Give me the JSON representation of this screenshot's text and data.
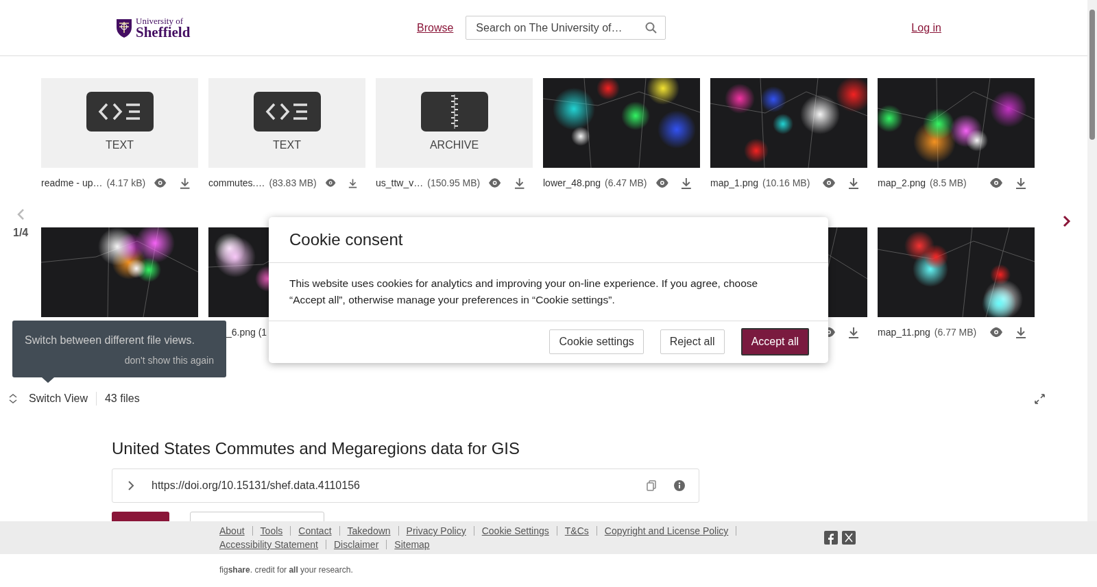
{
  "header": {
    "logo": {
      "line_1": "University of",
      "line_2": "Sheffield"
    },
    "nav_link": "Browse",
    "search": {
      "placeholder": "Search on The University of…"
    },
    "login_link": "Log in"
  },
  "carousel": {
    "page": "1/4",
    "rows": [
      [
        {
          "kind": "text",
          "type_label": "TEXT",
          "name": "readme - up…",
          "size": "(4.17 kB)",
          "actions": true
        },
        {
          "kind": "text",
          "type_label": "TEXT",
          "name": "commutes.…",
          "size": "(83.83 MB)",
          "actions": true
        },
        {
          "kind": "archive",
          "type_label": "ARCHIVE",
          "name": "us_ttw_v…",
          "size": "(150.95 MB)",
          "actions": true
        },
        {
          "kind": "picture",
          "name": "lower_48.png",
          "size": "(6.47 MB)",
          "actions": true
        },
        {
          "kind": "picture",
          "name": "map_1.png",
          "size": "(10.16 MB)",
          "actions": true
        },
        {
          "kind": "picture",
          "name": "map_2.png",
          "size": "(8.5 MB)",
          "actions": true
        }
      ],
      [
        {
          "kind": "picture",
          "actions": false
        },
        {
          "kind": "picture",
          "name": "_6.png (1",
          "clipped": true,
          "actions": false
        },
        {
          "kind": "hidden"
        },
        {
          "kind": "hidden"
        },
        {
          "kind": "picture",
          "actions": true
        },
        {
          "kind": "picture",
          "name": "map_11.png",
          "size": "(6.77 MB)",
          "actions": true
        }
      ]
    ]
  },
  "tooltip": {
    "text": "Switch between different file views.",
    "dismiss": "don't show this again"
  },
  "view_bar": {
    "switch_label": "Switch View",
    "count": "43 files"
  },
  "item": {
    "title": "United States Commutes and Megaregions data for GIS",
    "doi": "https://doi.org/10.15131/shef.data.4110156"
  },
  "cookie_dialog": {
    "title": "Cookie consent",
    "body": "This website uses cookies for analytics and improving your on-line experience. If you agree, choose “Accept all”, otherwise manage your preferences in “Cookie settings”.",
    "buttons": [
      {
        "label": "Cookie settings",
        "primary": false
      },
      {
        "label": "Reject all",
        "primary": false
      },
      {
        "label": "Accept all",
        "primary": true
      }
    ]
  },
  "footer": {
    "links": [
      [
        "About",
        "Tools",
        "Contact",
        "Takedown",
        "Privacy Policy",
        "Cookie Settings",
        "T&Cs",
        "Copyright and License Policy"
      ],
      [
        "Accessibility Statement",
        "Disclaimer",
        "Sitemap"
      ]
    ],
    "tagline": "fig**share**. credit for **all** your research."
  }
}
